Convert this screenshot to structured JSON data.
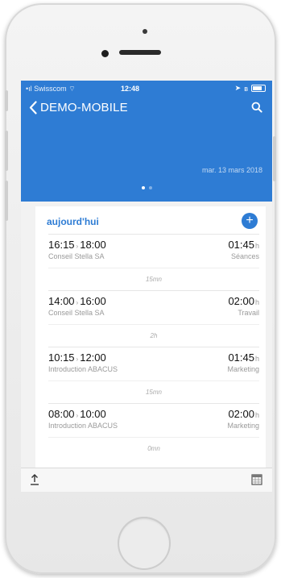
{
  "status": {
    "carrier": "Swisscom",
    "time": "12:48"
  },
  "nav": {
    "back_label": "DEMO-MOBILE"
  },
  "header": {
    "date": "mar. 13 mars 2018"
  },
  "list": {
    "day_title": "aujourd'hui",
    "entries": [
      {
        "start": "16:15",
        "end": "18:00",
        "client": "Conseil Stella SA",
        "duration": "01:45",
        "unit": "h",
        "category": "Séances"
      },
      {
        "start": "14:00",
        "end": "16:00",
        "client": "Conseil Stella SA",
        "duration": "02:00",
        "unit": "h",
        "category": "Travail"
      },
      {
        "start": "10:15",
        "end": "12:00",
        "client": "Introduction ABACUS",
        "duration": "01:45",
        "unit": "h",
        "category": "Marketing"
      },
      {
        "start": "08:00",
        "end": "10:00",
        "client": "Introduction ABACUS",
        "duration": "02:00",
        "unit": "h",
        "category": "Marketing"
      }
    ],
    "gaps": [
      "15mn",
      "2h",
      "15mn",
      "0mn"
    ]
  },
  "icons": {
    "back": "chevron-left-icon",
    "search": "search-icon",
    "add": "plus-icon",
    "export": "upload-icon",
    "calendar": "calendar-icon"
  },
  "colors": {
    "accent": "#2e7cd4"
  }
}
